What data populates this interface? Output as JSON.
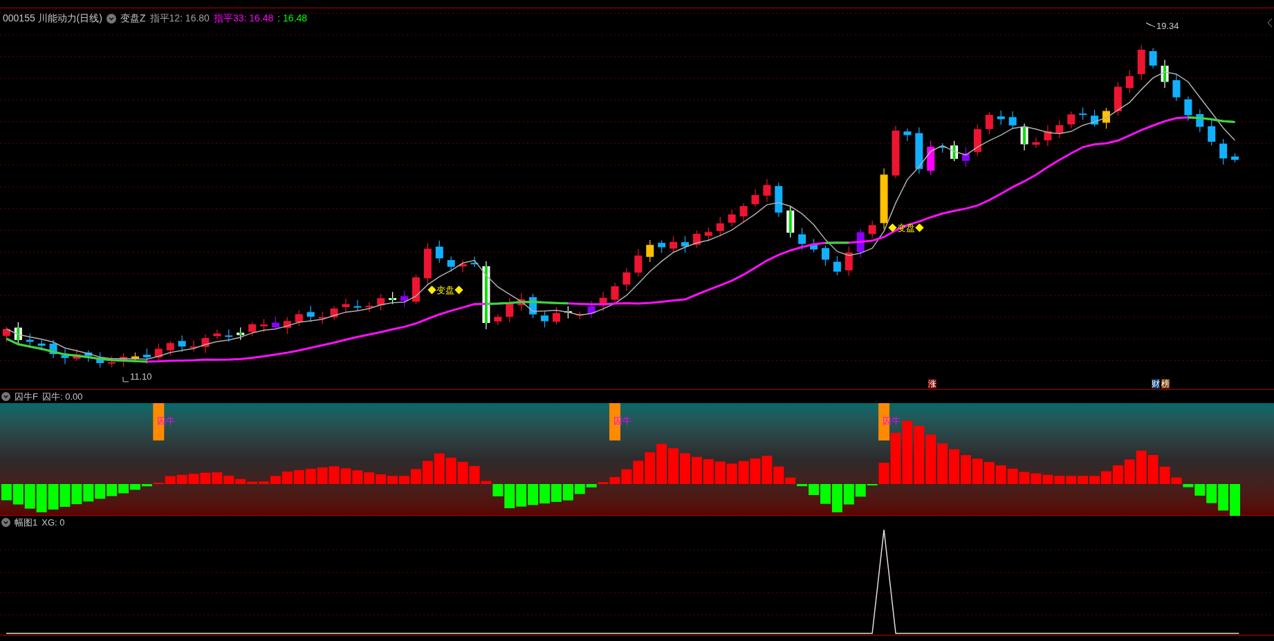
{
  "chart_header": {
    "symbol": "000155 川能动力(日线)",
    "indicator": "变盘Z",
    "ma12": "指平12: 16.80",
    "ma33": "指平33: 16.48",
    "ma33_value": ": 16.48"
  },
  "main_chart": {
    "high_label": "19.34",
    "low_label": "11.10",
    "signals": [
      {
        "text": "◆变盘◆"
      },
      {
        "text": "◆变盘◆"
      }
    ],
    "badges": [
      {
        "text": "涨",
        "color": "#7a0000"
      },
      {
        "text": "财",
        "color": "#0b3a6e"
      },
      {
        "text": "榜",
        "color": "#7a3c00"
      }
    ]
  },
  "panel_1": {
    "title": "囚牛F",
    "reading": "囚牛: 0.00",
    "signals": [
      "囚牛",
      "囚牛",
      "囚牛"
    ]
  },
  "panel_2": {
    "title": "幅图1",
    "reading": "XG: 0"
  }
}
